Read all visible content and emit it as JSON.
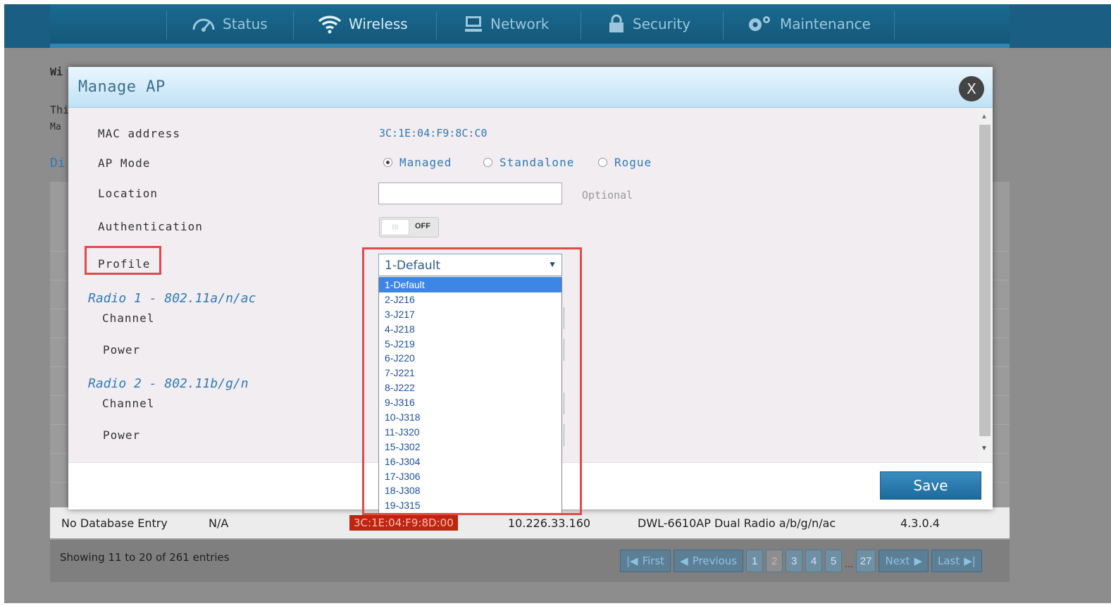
{
  "nav": {
    "items": [
      {
        "label": "Status",
        "icon": "gauge-icon"
      },
      {
        "label": "Wireless",
        "icon": "wifi-icon"
      },
      {
        "label": "Network",
        "icon": "monitor-icon"
      },
      {
        "label": "Security",
        "icon": "lock-icon"
      },
      {
        "label": "Maintenance",
        "icon": "gears-icon"
      }
    ]
  },
  "background": {
    "heading_fragment": "Wi",
    "text_fragment_1": "Thi",
    "text_fragment_2": "Ma",
    "section_fragment": "Di",
    "last_row": {
      "name": "No Database Entry",
      "na": "N/A",
      "mac": "3C:1E:04:F9:8D:00",
      "ip": "10.226.33.160",
      "model": "DWL-6610AP Dual Radio a/b/g/n/ac",
      "version": "4.3.0.4"
    },
    "showing": "Showing 11 to 20 of 261 entries",
    "pager": {
      "first": "First",
      "previous": "Previous",
      "pages": [
        "1",
        "2",
        "3",
        "4",
        "5"
      ],
      "ellipsis": "...",
      "last_page": "27",
      "next": "Next",
      "last": "Last"
    }
  },
  "modal": {
    "title": "Manage AP",
    "close_label": "X",
    "fields": {
      "mac_label": "MAC address",
      "mac_value": "3C:1E:04:F9:8C:C0",
      "ap_mode_label": "AP Mode",
      "ap_mode_options": [
        "Managed",
        "Standalone",
        "Rogue"
      ],
      "ap_mode_selected": "Managed",
      "location_label": "Location",
      "location_value": "",
      "location_hint": "Optional",
      "auth_label": "Authentication",
      "auth_toggle": "OFF",
      "auth_knob": "III",
      "profile_label": "Profile",
      "profile_selected": "1-Default"
    },
    "radio1": {
      "title": "Radio 1 - 802.11a/n/ac",
      "channel_label": "Channel",
      "power_label": "Power"
    },
    "radio2": {
      "title": "Radio 2 - 802.11b/g/n",
      "channel_label": "Channel",
      "power_label": "Power"
    },
    "profile_options": [
      "1-Default",
      "2-J216",
      "3-J217",
      "4-J218",
      "5-J219",
      "6-J220",
      "7-J221",
      "8-J222",
      "9-J316",
      "10-J318",
      "11-J320",
      "15-J302",
      "16-J304",
      "17-J306",
      "18-J308",
      "19-J315"
    ],
    "save_label": "Save"
  },
  "colors": {
    "nav_bg": "#14587a",
    "accent_blue": "#2f7ab8",
    "highlight_red": "#e04a4a",
    "selected_option": "#3d86e6"
  }
}
